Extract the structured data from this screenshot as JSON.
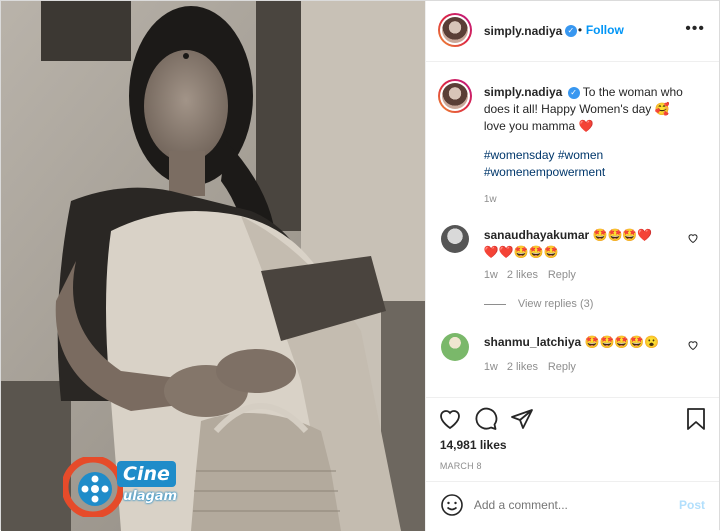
{
  "header": {
    "username": "simply.nadiya",
    "separator": "•",
    "follow_label": "Follow",
    "more_icon": "more-options-icon"
  },
  "caption": {
    "username": "simply.nadiya",
    "text": "To the woman who does it all! Happy Women's day 🥰 love you mamma ❤️",
    "hashtags": "#womensday #women #womenempowerment",
    "time": "1w"
  },
  "comments": [
    {
      "username": "sanaudhayakumar",
      "text": "🤩🤩🤩❤️ ❤️❤️🤩🤩🤩",
      "time": "1w",
      "likes": "2 likes",
      "reply_label": "Reply",
      "view_replies": "View replies (3)"
    },
    {
      "username": "shanmu_latchiya",
      "text": "🤩🤩🤩🤩😮",
      "time": "1w",
      "likes": "2 likes",
      "reply_label": "Reply"
    }
  ],
  "actions": {
    "likes": "14,981 likes",
    "date": "MARCH 8"
  },
  "comment_box": {
    "placeholder": "Add a comment...",
    "post_label": "Post"
  },
  "watermark": {
    "line1": "Cine",
    "line2": "ulagam"
  }
}
